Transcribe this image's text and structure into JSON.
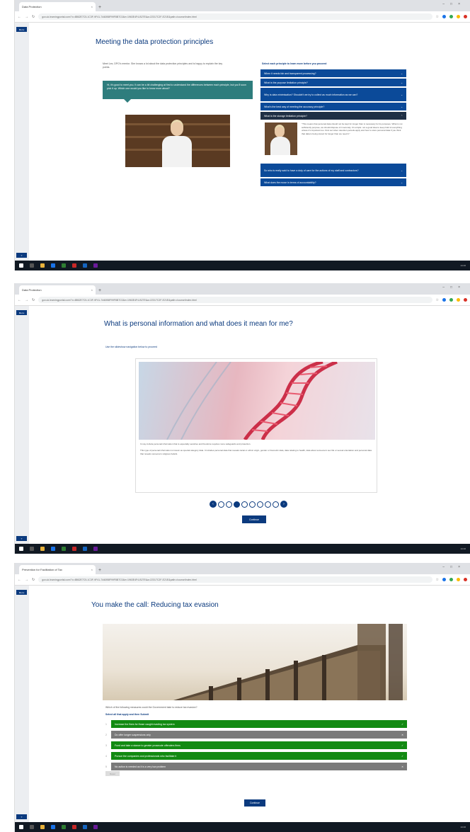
{
  "screens": [
    {
      "tab_title": "Data Protection",
      "url": "gov.uk.learningportal.com/?c=8862E7C5-1C3F-9F41-7A60B8F99F8B7C0&e=1963E4F4-B27E&a=22317C2F-E21E&path=/course/index.html",
      "page_title": "Meeting the data protection principles",
      "intro": "Meet Lex, DPO's mentor. She knows a lot about the data protection principles and is happy to explain the key points.",
      "bubble": "Hi, it's good to meet you. It can be a bit challenging at first to understand the differences between each principle, but you'll soon pick it up. Which one would you like to know more about?",
      "accordion_intro": "Select each principle to learn more before you proceed",
      "accordion": [
        "When it needs fair and transparent processing?",
        "What is the purpose limitation principle?",
        "Why is data minimisation? Shouldn't we try to collect as much information as we can?",
        "What's the best way of meeting the accuracy principle?",
        "What is the storage limitation principle?",
        "So who is really said to have a duty of care for the actions of my staff and contractors?",
        "What does the move in terms of accountability?"
      ],
      "panel_text": "\"This means that personal data should not be kept for longer than is necessary for its purposes. What is not sufficiently purpose, we should dispose of it securely. It's simple: not a good idea to keep hold of everything unless it's important too. Find out when retention periods apply and how to store personal data if you think that data is being stored for longer than we need it.\""
    },
    {
      "tab_title": "Data Protection",
      "url": "gov.uk.learningportal.com/?c=8862E7C5-1C3F-9F41-7A60B8F99F8B7C0&e=1963E4F4-B27E&a=22317C2F-E21E&path=/course/index.html",
      "page_title": "What is personal information and what does it mean for me?",
      "nav_hint": "Use the slideshow navigation below to proceed",
      "slide_text_1": "It may include personal information that is especially sensitive and therefore requires more safeguards and protection.",
      "slide_text_2": "This type of personal information is known as special category data. It includes personal data that reveals racial or ethnic origin, gender or biometric data, data relating to health, data about someone's sex life or sexual orientation and personal data that reveals someone's religious beliefs.",
      "continue_label": "Continue",
      "pager_current": 4,
      "pager_total": 8
    },
    {
      "tab_title": "Prevention for Facilitation of Tax",
      "url": "gov.uk.learningportal.com/?c=8862E7C5-1C3F-9F41-7A60B8F99F8B7C0&e=1963E4F4-B27E&a=22317C2F-E21E&path=/course/index.html",
      "page_title": "You make the call: Reducing tax evasion",
      "question": "Which of the following measures could the Government take to reduce tax evasion?",
      "select_hint": "Select all that apply and then Submit",
      "options": [
        {
          "label": "Increase the fines for those caught evading tax system",
          "correct": true
        },
        {
          "label": "Do offer longer suspensions only",
          "correct": false
        },
        {
          "label": "Fund and take a stance to greater prosecute offenders firms",
          "correct": true
        },
        {
          "label": "Pursue the companies and professionals who facilitate it",
          "correct": true
        },
        {
          "label": "No action is needed as it is a very low problem",
          "correct": false
        }
      ],
      "reset_label": "Reset",
      "continue_label": "Continue"
    }
  ],
  "side_label": "Menu",
  "status_time": "14:16"
}
